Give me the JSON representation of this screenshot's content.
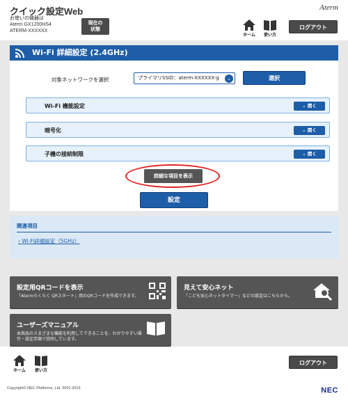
{
  "header": {
    "title": "クイック設定Web",
    "device_label": "お使いの機器は",
    "device_model": "Aterm GX1200HS4",
    "device_ssid": "ATERM-XXXXXX",
    "status_button": [
      "現在の",
      "状態"
    ],
    "brand": "Aterm",
    "home_label": "ホーム",
    "usage_label": "使い方",
    "logout_label": "ログアウト"
  },
  "page": {
    "title": "Wi-Fi 詳細設定 (2.4GHz)",
    "target_network_label": "対象ネットワークを選択",
    "ssid_select_value": "プライマリSSID：aterm-XXXXXX-g",
    "select_button": "選択",
    "accordions": [
      {
        "label": "Wi-Fi 機能設定",
        "button": "開く"
      },
      {
        "label": "暗号化",
        "button": "開く"
      },
      {
        "label": "子機の接続制限",
        "button": "開く"
      }
    ],
    "show_detail_button": "詳細な項目を表示",
    "save_button": "設定"
  },
  "related": {
    "title": "関連項目",
    "link": "Wi-Fi詳細設定（5GHz）"
  },
  "cards": {
    "qr": {
      "title": "設定用QRコードを表示",
      "desc": "「Atermらくらく QRスタート」用のQRコードを作成できます。"
    },
    "timer": {
      "title": "見えて安心ネット",
      "desc": "「こども安心ネットタイマー」などの設定はこちらから。"
    },
    "manual": {
      "title": "ユーザーズマニュアル",
      "desc": "本商品のさまざまな機能を利用してできることを、わかりやすい操作・設定手順で説明しています。"
    }
  },
  "footer": {
    "home_label": "ホーム",
    "usage_label": "使い方",
    "logout_label": "ログアウト",
    "copyright": "Copyright© NEC Platforms, Ltd. 2001-2019",
    "maker": "NEC"
  },
  "colors": {
    "primary_blue": "#1e5ea8",
    "dark_button": "#4a4a4a",
    "highlight_red": "#e02020",
    "panel_gray": "#e8e8e8",
    "accordion_bg": "#e6f1fb"
  },
  "icons": [
    "home-icon",
    "book-icon",
    "wifi-icon",
    "chevron-down-icon",
    "qr-code-icon",
    "house-search-icon"
  ]
}
